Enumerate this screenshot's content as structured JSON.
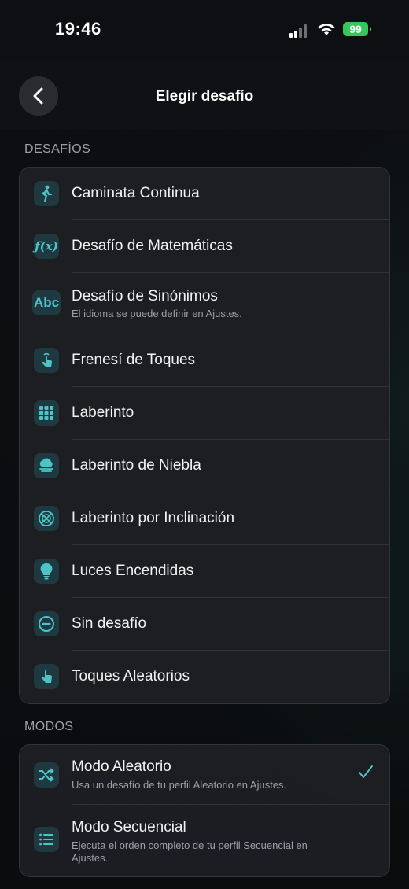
{
  "status_bar": {
    "time": "19:46",
    "battery": "99"
  },
  "navbar": {
    "title": "Elegir desafío"
  },
  "sections": {
    "challenges_label": "DESAFÍOS",
    "modes_label": "MODOS"
  },
  "challenges": [
    {
      "label": "Caminata Continua",
      "icon": "walk-icon"
    },
    {
      "label": "Desafío de Matemáticas",
      "icon": "function-icon"
    },
    {
      "label": "Desafío de Sinónimos",
      "sub": "El idioma se puede definir en Ajustes.",
      "icon": "abc-icon"
    },
    {
      "label": "Frenesí de Toques",
      "icon": "tap-icon"
    },
    {
      "label": "Laberinto",
      "icon": "grid-icon"
    },
    {
      "label": "Laberinto de Niebla",
      "icon": "fog-icon"
    },
    {
      "label": "Laberinto por Inclinación",
      "icon": "tilt-icon"
    },
    {
      "label": "Luces Encendidas",
      "icon": "lightbulb-icon"
    },
    {
      "label": "Sin desafío",
      "icon": "minus-circle-icon"
    },
    {
      "label": "Toques Aleatorios",
      "icon": "hand-tap-icon"
    }
  ],
  "modes": [
    {
      "label": "Modo Aleatorio",
      "sub": "Usa un desafío de tu perfil Aleatorio en Ajustes.",
      "icon": "shuffle-icon",
      "selected": true
    },
    {
      "label": "Modo Secuencial",
      "sub": "Ejecuta el orden completo de tu perfil Secuencial en Ajustes.",
      "icon": "list-icon",
      "selected": false
    }
  ],
  "colors": {
    "accent": "#4fc3c8",
    "icon_bg": "#1e3a40",
    "battery": "#34c759"
  }
}
